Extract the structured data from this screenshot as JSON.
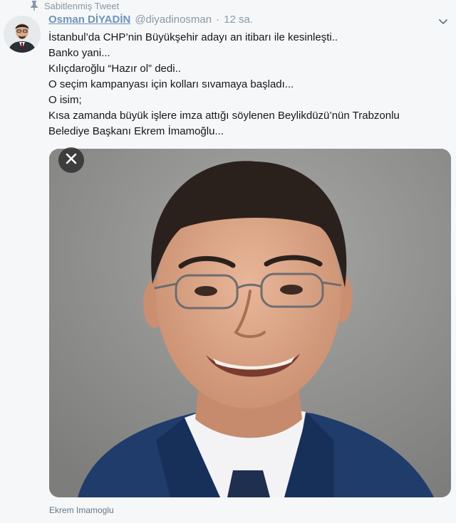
{
  "pinned_label": "Sabitlenmiş Tweet",
  "author": {
    "name": "Osman DİYADİN",
    "handle": "@diyadinosman",
    "separator": "·",
    "time": "12 sa."
  },
  "tweet_lines": [
    "İstanbul’da CHP’nin Büyükşehir adayı an itibarı ile kesinleşti..",
    "Banko yani...",
    "Kılıçdaroğlu “Hazır ol” dedi..",
    "O seçim kampanyası için kolları sıvamaya başladı...",
    "O isim;",
    "Kısa zamanda büyük işlere imza attığı söylenen Beylikdüzü’nün Trabzonlu",
    "Belediye Başkanı Ekrem İmamoğlu..."
  ],
  "media": {
    "caption": "Ekrem Imamoglu"
  },
  "icons": {
    "pin": "pin-icon",
    "caret": "chevron-down-icon",
    "close": "close-icon"
  },
  "colors": {
    "name": "#6f93b8",
    "muted": "#8899a6",
    "text": "#14171a",
    "background": "#f5f7f9"
  }
}
